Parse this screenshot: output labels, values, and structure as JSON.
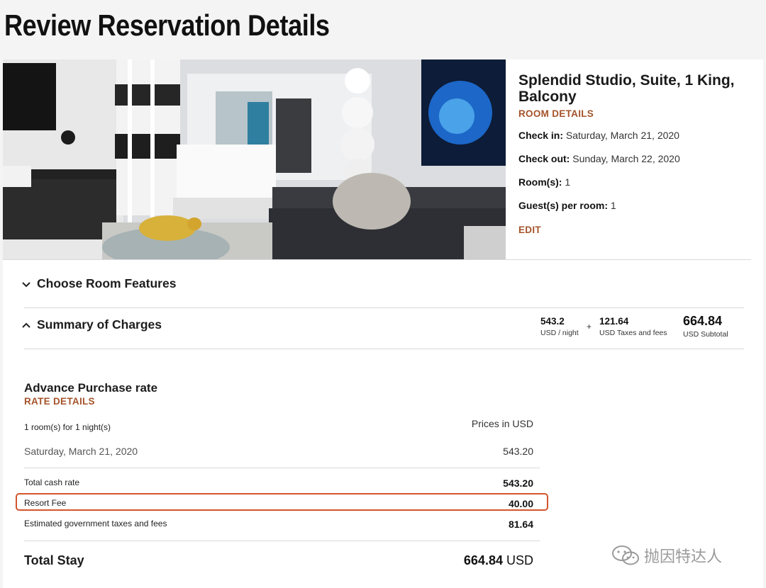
{
  "page_title": "Review Reservation Details",
  "room": {
    "name": "Splendid Studio, Suite, 1 King, Balcony",
    "details_link": "ROOM DETAILS",
    "check_in_label": "Check in:",
    "check_in_value": "Saturday, March 21, 2020",
    "check_out_label": "Check out:",
    "check_out_value": "Sunday, March 22, 2020",
    "rooms_label": "Room(s):",
    "rooms_value": "1",
    "guests_label": "Guest(s) per room:",
    "guests_value": "1",
    "edit_link": "EDIT"
  },
  "features": {
    "label": "Choose Room Features"
  },
  "summary": {
    "label": "Summary of Charges",
    "nightly_value": "543.2",
    "nightly_label": "USD / night",
    "plus": "+",
    "taxes_value": "121.64",
    "taxes_label": "USD Taxes and fees",
    "subtotal_value": "664.84",
    "subtotal_label": "USD Subtotal"
  },
  "rate": {
    "title": "Advance Purchase rate",
    "details_link": "RATE DETAILS",
    "rooms_nights": "1 room(s) for 1 night(s)",
    "prices_in": "Prices in USD",
    "date_label": "Saturday, March 21, 2020",
    "date_value": "543.20",
    "total_cash_label": "Total cash rate",
    "total_cash_value": "543.20",
    "resort_fee_label": "Resort Fee",
    "resort_fee_value": "40.00",
    "gov_taxes_label": "Estimated government taxes and fees",
    "gov_taxes_value": "81.64",
    "total_stay_label": "Total Stay",
    "total_stay_value": "664.84",
    "total_stay_currency": "USD"
  },
  "watermark": {
    "text": "抛因特达人",
    "icon": "wechat-icon"
  },
  "colors": {
    "accent": "#a5532a",
    "highlight": "#d3552c"
  }
}
